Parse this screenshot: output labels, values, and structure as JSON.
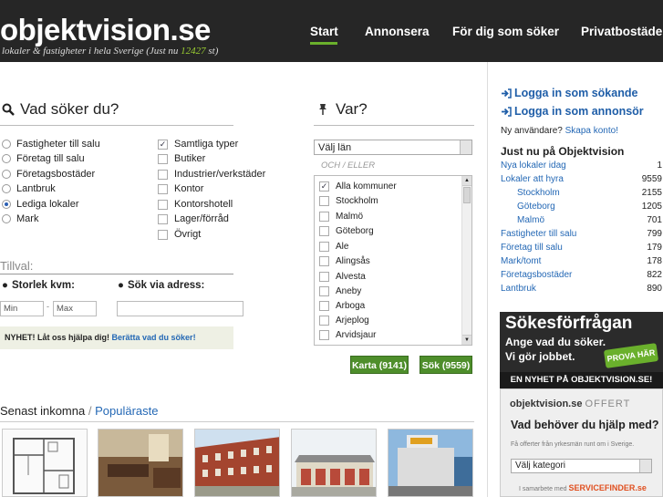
{
  "header": {
    "logo": "objektvision.se",
    "tagline_prefix": "lokaler & fastigheter i hela Sverige (Just nu ",
    "tagline_count": "12427",
    "tagline_suffix": " st)",
    "nav": [
      "Start",
      "Annonsera",
      "För dig som söker",
      "Privatbostäder"
    ]
  },
  "search": {
    "heading": "Vad söker du?",
    "types_left": [
      {
        "label": "Fastigheter till salu",
        "selected": false
      },
      {
        "label": "Företag till salu",
        "selected": false
      },
      {
        "label": "Företagsbostäder",
        "selected": false
      },
      {
        "label": "Lantbruk",
        "selected": false
      },
      {
        "label": "Lediga lokaler",
        "selected": true
      },
      {
        "label": "Mark",
        "selected": false
      }
    ],
    "types_right": [
      {
        "label": "Samtliga typer",
        "checked": true
      },
      {
        "label": "Butiker",
        "checked": false
      },
      {
        "label": "Industrier/verkstäder",
        "checked": false
      },
      {
        "label": "Kontor",
        "checked": false
      },
      {
        "label": "Kontorshotell",
        "checked": false
      },
      {
        "label": "Lager/förråd",
        "checked": false
      },
      {
        "label": "Övrigt",
        "checked": false
      }
    ],
    "tillval": "Tillval:",
    "size_label": "Storlek kvm:",
    "min_placeholder": "Min",
    "max_placeholder": "Max",
    "dash": "-",
    "address_label": "Sök via adress:",
    "nyhet_bold": "NYHET! Låt oss hjälpa dig!",
    "nyhet_link": "Berätta vad du söker!"
  },
  "where": {
    "heading": "Var?",
    "lan_select": "Välj län",
    "or": "OCH / ELLER",
    "kommuner": [
      {
        "label": "Alla kommuner",
        "checked": true
      },
      {
        "label": "Stockholm",
        "checked": false
      },
      {
        "label": "Malmö",
        "checked": false
      },
      {
        "label": "Göteborg",
        "checked": false
      },
      {
        "label": "Ale",
        "checked": false
      },
      {
        "label": "Alingsås",
        "checked": false
      },
      {
        "label": "Alvesta",
        "checked": false
      },
      {
        "label": "Aneby",
        "checked": false
      },
      {
        "label": "Arboga",
        "checked": false
      },
      {
        "label": "Arjeplog",
        "checked": false
      },
      {
        "label": "Arvidsjaur",
        "checked": false
      }
    ],
    "btn_karta": "Karta (9141)",
    "btn_sok": "Sök (9559)"
  },
  "latest": {
    "title": "Senast inkomna",
    "sep": "/",
    "popular": "Populäraste"
  },
  "sidebar": {
    "login_seeker": "Logga in som sökande",
    "login_advertiser": "Logga in som annonsör",
    "new_user": "Ny användare?",
    "create_account": "Skapa konto!",
    "just_now": "Just nu på Objektvision",
    "stats": [
      {
        "label": "Nya lokaler idag",
        "value": "1",
        "indent": false
      },
      {
        "label": "Lokaler att hyra",
        "value": "9559",
        "indent": false
      },
      {
        "label": "Stockholm",
        "value": "2155",
        "indent": true
      },
      {
        "label": "Göteborg",
        "value": "1205",
        "indent": true
      },
      {
        "label": "Malmö",
        "value": "701",
        "indent": true
      },
      {
        "label": "Fastigheter till salu",
        "value": "799",
        "indent": false
      },
      {
        "label": "Företag till salu",
        "value": "179",
        "indent": false
      },
      {
        "label": "Mark/tomt",
        "value": "178",
        "indent": false
      },
      {
        "label": "Företagsbostäder",
        "value": "822",
        "indent": false
      },
      {
        "label": "Lantbruk",
        "value": "890",
        "indent": false
      }
    ],
    "ad": {
      "title": "Sökesförfrågan",
      "line1": "Ange vad du söker.",
      "line2": "Vi gör jobbet.",
      "button": "PROVA HÄR",
      "banner": "EN NYHET PÅ OBJEKTVISION.SE!"
    },
    "offert": {
      "brand": "objektvision.se",
      "offert": "OFFERT",
      "question": "Vad behöver du hjälp med?",
      "sub": "Få offerter från yrkesmän runt om i Sverige.",
      "select": "Välj kategori",
      "coop": "I samarbete med",
      "partner": "SERVICEFINDER.se"
    }
  }
}
